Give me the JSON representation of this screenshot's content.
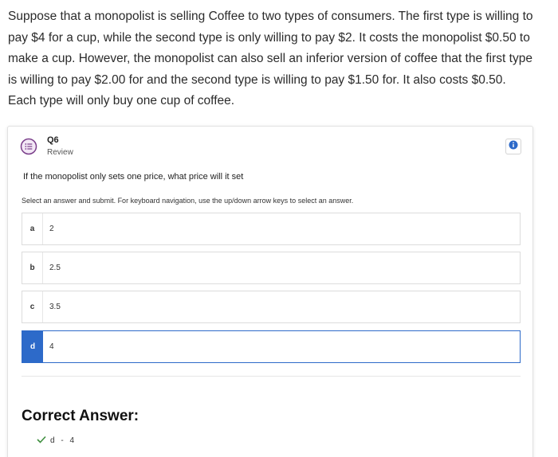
{
  "intro": "Suppose that a monopolist is selling Coffee to two types of consumers. The first type is willing to pay $4 for a cup, while the second type is only willing to pay $2. It costs the monopolist $0.50 to make a cup. However, the monopolist can also sell an inferior version of coffee that the first type is willing to pay $2.00 for and the second type is willing to pay $1.50 for. It also costs $0.50. Each type will only buy one cup of coffee.",
  "question_header": {
    "number": "Q6",
    "subtitle": "Review"
  },
  "question": "If the monopolist only sets one price, what price will it set",
  "instructions": "Select an answer and submit. For keyboard navigation, use the up/down arrow keys to select an answer.",
  "options": [
    {
      "letter": "a",
      "value": "2"
    },
    {
      "letter": "b",
      "value": "2.5"
    },
    {
      "letter": "c",
      "value": "3.5"
    },
    {
      "letter": "d",
      "value": "4"
    }
  ],
  "selected_option": "d",
  "correct_answer": {
    "title": "Correct Answer:",
    "letter": "d",
    "separator": " - ",
    "value": "4"
  },
  "colors": {
    "accent": "#2d6ac9",
    "check": "#3f8f3f",
    "icon": "#7a3e8a"
  },
  "icons": {
    "question": "question-list-icon",
    "info": "info-icon",
    "check": "checkmark-icon"
  }
}
